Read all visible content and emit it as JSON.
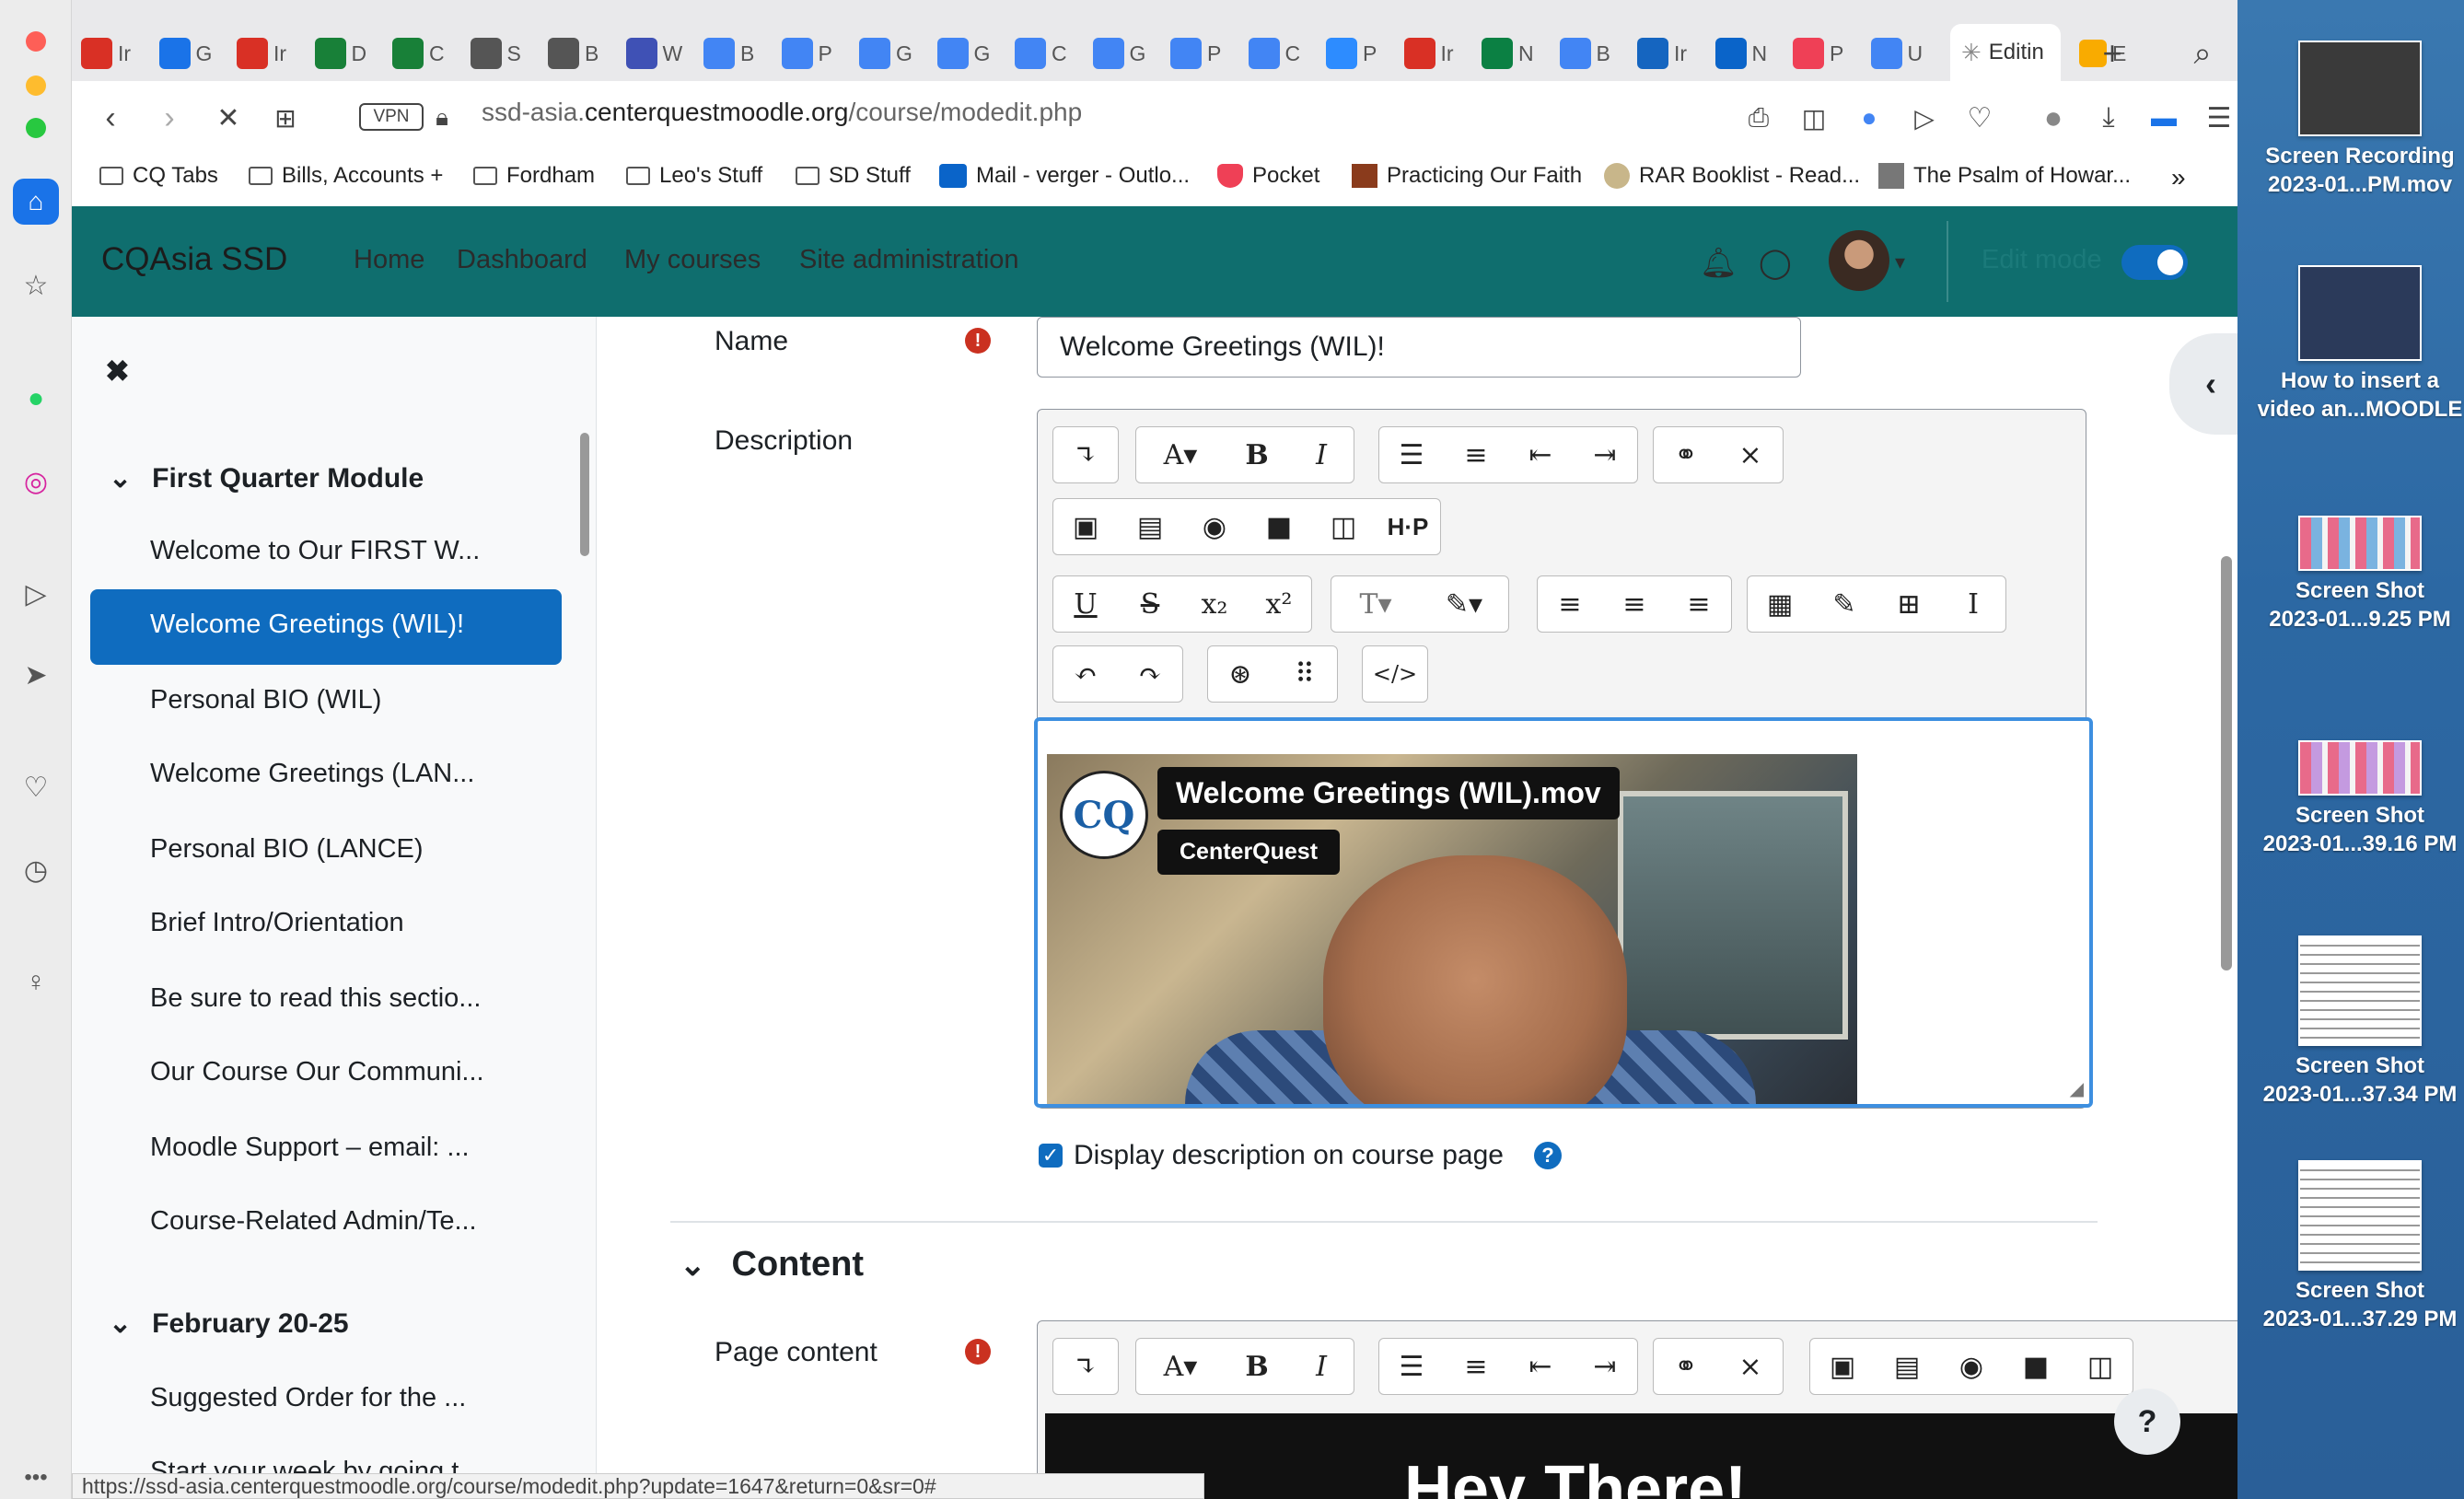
{
  "browser": {
    "tabs": [
      {
        "icon": "gmail-icon",
        "label": "Ir",
        "color": "#d93025"
      },
      {
        "icon": "calendar-icon",
        "label": "G",
        "color": "#1a73e8"
      },
      {
        "icon": "gmail-icon",
        "label": "Ir",
        "color": "#d93025"
      },
      {
        "icon": "sheets-icon",
        "label": "D",
        "color": "#188038"
      },
      {
        "icon": "sheets-icon",
        "label": "C",
        "color": "#188038"
      },
      {
        "icon": "globe-icon",
        "label": "S",
        "color": "#555555"
      },
      {
        "icon": "globe-icon",
        "label": "B",
        "color": "#555555"
      },
      {
        "icon": "weather-icon",
        "label": "W",
        "color": "#3f51b5"
      },
      {
        "icon": "b-icon",
        "label": "B",
        "color": "#4285f4"
      },
      {
        "icon": "docs-icon",
        "label": "P",
        "color": "#4285f4"
      },
      {
        "icon": "docs-icon",
        "label": "G",
        "color": "#4285f4"
      },
      {
        "icon": "docs-icon",
        "label": "G",
        "color": "#4285f4"
      },
      {
        "icon": "docs-icon",
        "label": "C",
        "color": "#4285f4"
      },
      {
        "icon": "docs-icon",
        "label": "G",
        "color": "#4285f4"
      },
      {
        "icon": "docs-icon",
        "label": "P",
        "color": "#4285f4"
      },
      {
        "icon": "docs-icon",
        "label": "C",
        "color": "#4285f4"
      },
      {
        "icon": "zoom-icon",
        "label": "P",
        "color": "#2d8cff"
      },
      {
        "icon": "gmail-icon",
        "label": "Ir",
        "color": "#d93025"
      },
      {
        "icon": "leaf-icon",
        "label": "N",
        "color": "#0b8043"
      },
      {
        "icon": "gear-icon",
        "label": "B",
        "color": "#4285f4"
      },
      {
        "icon": "circle-icon",
        "label": "Ir",
        "color": "#1565c0"
      },
      {
        "icon": "outlook-icon",
        "label": "N",
        "color": "#0a64c9"
      },
      {
        "icon": "pocket-icon",
        "label": "P",
        "color": "#ef4056"
      },
      {
        "icon": "docs-icon",
        "label": "U",
        "color": "#4285f4"
      }
    ],
    "active_tab_label": "Editin",
    "next_tab_label": "E",
    "url_prefix": "ssd-asia.",
    "url_domain": "centerquestmoodle.org",
    "url_path": "/course/modedit.php",
    "bookmarks": [
      "CQ Tabs",
      "Bills, Accounts +",
      "Fordham",
      "Leo's Stuff",
      "SD Stuff",
      "Mail - verger - Outlo...",
      "Pocket",
      "Practicing Our Faith",
      "RAR Booklist - Read...",
      "The Psalm of Howar..."
    ],
    "status_url": "https://ssd-asia.centerquestmoodle.org/course/modedit.php?update=1647&return=0&sr=0#",
    "vpn": "VPN"
  },
  "moodle": {
    "brand": "CQAsia SSD",
    "nav": [
      "Home",
      "Dashboard",
      "My courses",
      "Site administration"
    ],
    "edit_mode": "Edit mode",
    "edit_mode_on": true
  },
  "drawer": {
    "section1": "First Quarter Module",
    "items1": [
      "Welcome to Our FIRST W...",
      "Welcome Greetings (WIL)!",
      "Personal BIO (WIL)",
      "Welcome Greetings (LAN...",
      "Personal BIO (LANCE)",
      "Brief Intro/Orientation",
      "Be sure to read this sectio...",
      "Our Course Our Communi...",
      "Moodle Support – email: ...",
      "Course-Related Admin/Te..."
    ],
    "active_index": 1,
    "section2": "February 20-25",
    "items2": [
      "Suggested Order for the ...",
      "Start your week by going t..."
    ]
  },
  "form": {
    "name_label": "Name",
    "name_value": "Welcome Greetings (WIL)!",
    "description_label": "Description",
    "video_title": "Welcome Greetings (WIL).mov",
    "video_channel": "CenterQuest",
    "video_logo": "CQ",
    "display_desc_label": "Display description on course page",
    "display_desc_checked": true,
    "content_section": "Content",
    "page_content_label": "Page content",
    "page_content_preview": "Hey There!"
  },
  "desktop": {
    "files": [
      {
        "label1": "Screen Recording",
        "label2": "2023-01...PM.mov"
      },
      {
        "label1": "How to insert a",
        "label2": "video an...MOODLE"
      },
      {
        "label1": "Screen Shot",
        "label2": "2023-01...9.25 PM"
      },
      {
        "label1": "Screen Shot",
        "label2": "2023-01...39.16 PM"
      },
      {
        "label1": "Screen Shot",
        "label2": "2023-01...37.34 PM"
      },
      {
        "label1": "Screen Shot",
        "label2": "2023-01...37.29 PM"
      }
    ]
  }
}
